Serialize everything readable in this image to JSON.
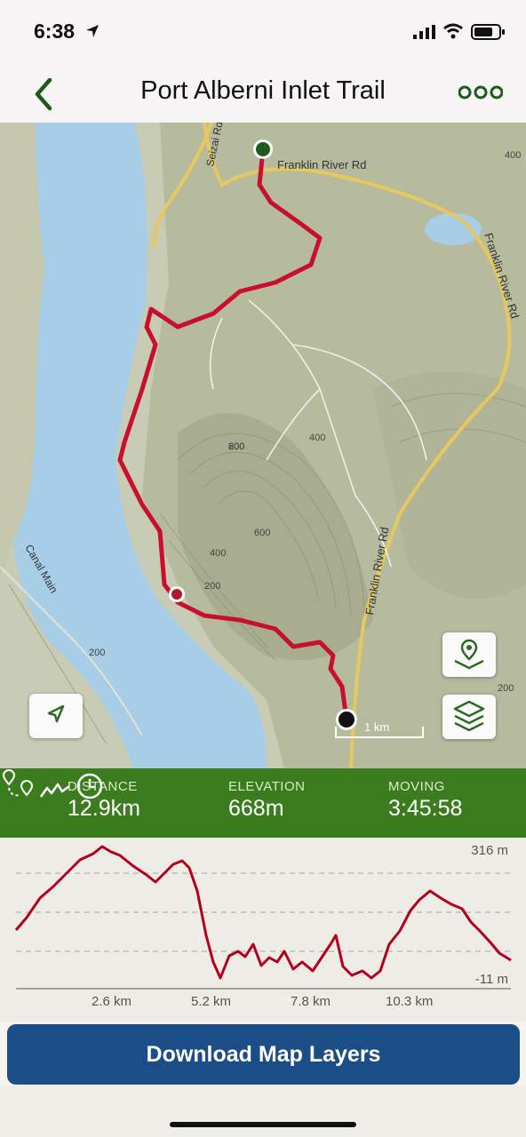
{
  "status_bar": {
    "time": "6:38"
  },
  "header": {
    "title": "Port Alberni Inlet Trail"
  },
  "map": {
    "road_labels": [
      "Franklin River Rd",
      "Franklin River Rd",
      "Franklin River Rd",
      "Seizai Rd",
      "Canal Main"
    ],
    "contour_labels": [
      "200",
      "400",
      "600",
      "600",
      "400",
      "200",
      "400",
      "200",
      "200"
    ],
    "scale_label": "1 km"
  },
  "stats": {
    "distance": {
      "label": "DISTANCE",
      "value": "12.9km"
    },
    "elevation": {
      "label": "ELEVATION",
      "value": "668m"
    },
    "moving": {
      "label": "MOVING",
      "value": "3:45:58"
    }
  },
  "elevation_chart": {
    "y_max_label": "316 m",
    "y_min_label": "-11 m",
    "x_labels": [
      "2.6 km",
      "5.2 km",
      "7.8 km",
      "10.3 km"
    ]
  },
  "download_button": {
    "label": "Download Map Layers"
  },
  "colors": {
    "accent_green": "#3b7d1e",
    "trail_red": "#c8102e",
    "button_blue": "#1b4d86",
    "water": "#a8cde6"
  }
}
